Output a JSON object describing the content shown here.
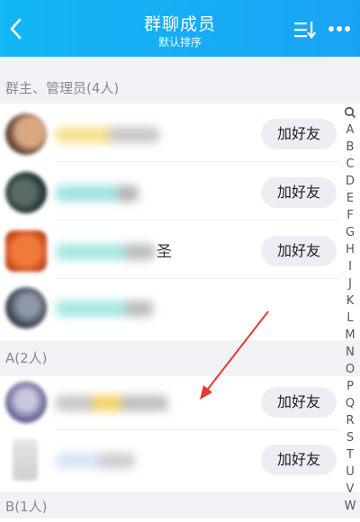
{
  "header": {
    "title": "群聊成员",
    "subtitle": "默认排序"
  },
  "sections": {
    "admins": "群主、管理员(4人)",
    "a": "A(2人)",
    "b": "B(1人)"
  },
  "members": [
    {
      "name_tail": "",
      "add_label": "加好友"
    },
    {
      "name_tail": "",
      "add_label": "加好友"
    },
    {
      "name_tail": "圣",
      "add_label": "加好友"
    },
    {
      "name_tail": "",
      "add_label": ""
    },
    {
      "name_tail": "",
      "add_label": "加好友"
    },
    {
      "name_tail": "",
      "add_label": "加好友"
    }
  ],
  "index_letters": [
    "A",
    "B",
    "C",
    "D",
    "E",
    "F",
    "G",
    "H",
    "I",
    "J",
    "K",
    "L",
    "M",
    "N",
    "O",
    "P",
    "Q",
    "R",
    "S",
    "T",
    "U",
    "V",
    "W"
  ],
  "colors": {
    "accent": "#12b7f5",
    "arrow": "#e53935"
  }
}
